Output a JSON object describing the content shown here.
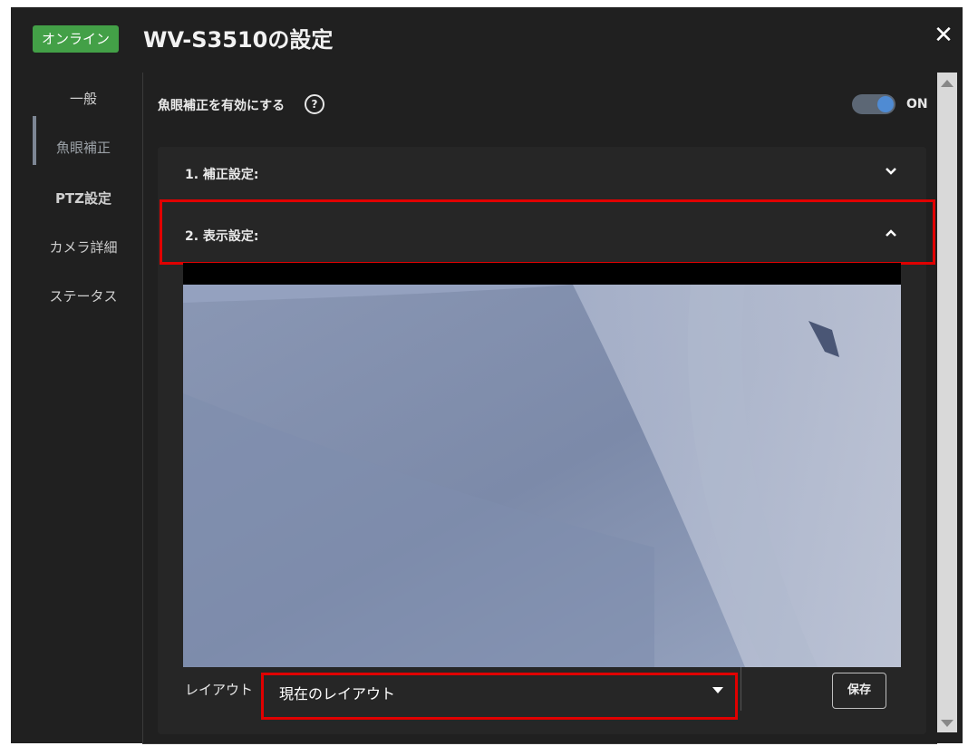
{
  "window": {
    "status_badge": "オンライン",
    "title": "WV-S3510の設定",
    "close_glyph": "✕"
  },
  "sidebar": {
    "items": [
      {
        "label": "一般"
      },
      {
        "label": "魚眼補正",
        "active": true
      },
      {
        "label": "PTZ設定"
      },
      {
        "label": "カメラ詳細"
      },
      {
        "label": "ステータス"
      }
    ]
  },
  "fisheye": {
    "label": "魚眼補正を有効にする",
    "help_icon": "?",
    "toggle_on": true,
    "toggle_text": "ON"
  },
  "sections": {
    "correction": {
      "title": "1. 補正設定:",
      "expanded": false,
      "chevron": "⌄"
    },
    "display": {
      "title": "2. 表示設定:",
      "expanded": true,
      "chevron": "⌃"
    }
  },
  "layout": {
    "label": "レイアウト",
    "selected": "現在のレイアウト"
  },
  "buttons": {
    "save": "保存"
  },
  "colors": {
    "badge": "#43a047",
    "highlight": "#e00000",
    "toggle_knob": "#4f8bd3",
    "background": "#202020"
  }
}
